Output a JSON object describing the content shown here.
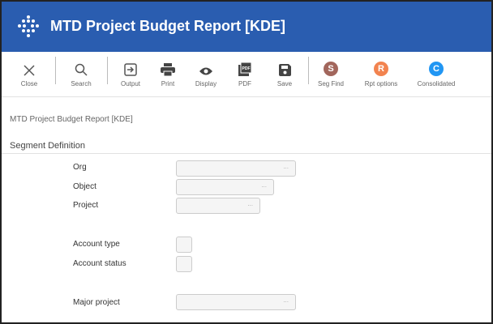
{
  "window": {
    "title": "MTD Project Budget Report [KDE]"
  },
  "toolbar": {
    "close": "Close",
    "search": "Search",
    "output": "Output",
    "print": "Print",
    "display": "Display",
    "pdf": "PDF",
    "save": "Save",
    "seg_find": "Seg Find",
    "rpt_options": "Rpt options",
    "consolidated": "Consolidated",
    "seg_find_letter": "S",
    "rpt_options_letter": "R",
    "consolidated_letter": "C",
    "pdf_icon_text": "PDF"
  },
  "colors": {
    "header": "#2a5db0",
    "seg_find": "#a2665c",
    "rpt_options": "#f2834f",
    "consolidated": "#2196f3"
  },
  "page": {
    "breadcrumb": "MTD Project Budget Report [KDE]",
    "section_title": "Segment Definition"
  },
  "fields": {
    "org": "Org",
    "object": "Object",
    "project": "Project",
    "account_type": "Account type",
    "account_status": "Account status",
    "major_project": "Major project",
    "lookup_dots": "..."
  },
  "icons": [
    "logo-icon",
    "close-icon",
    "search-icon",
    "output-icon",
    "print-icon",
    "display-icon",
    "pdf-icon",
    "save-icon"
  ]
}
